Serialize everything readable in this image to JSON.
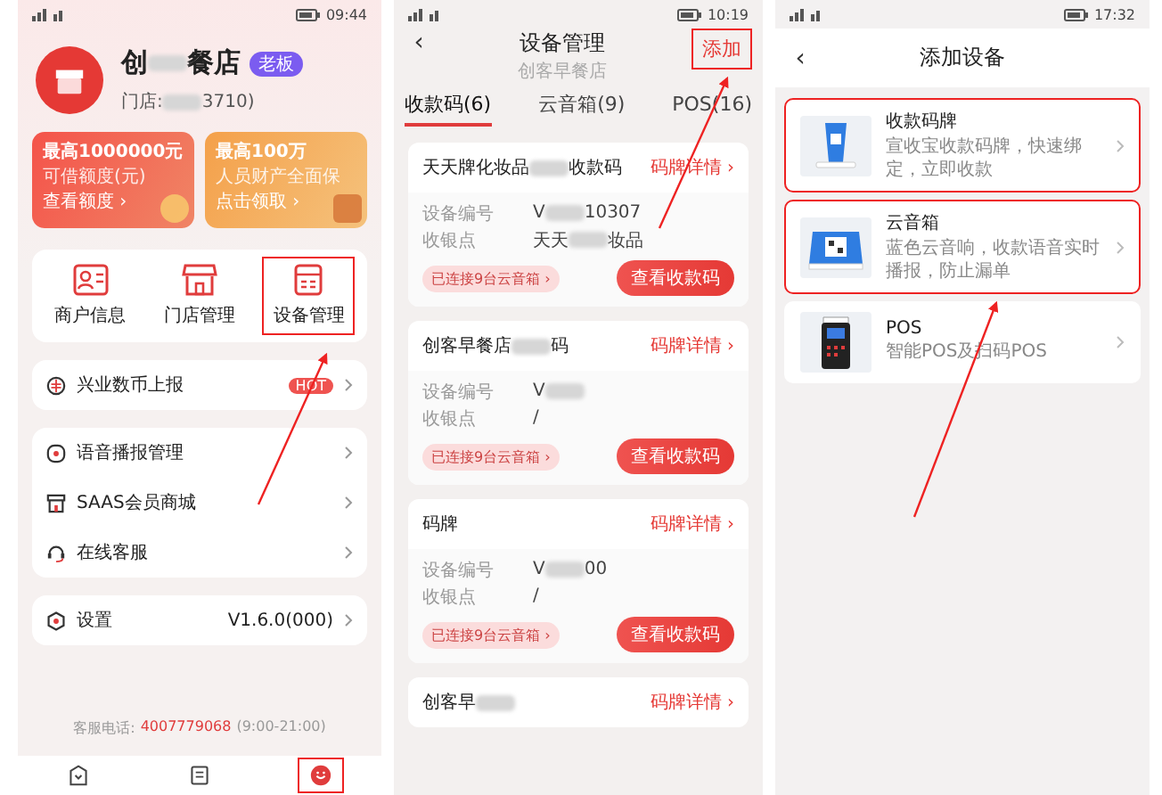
{
  "merchant_screen": {
    "status_bar": {
      "time": "09:44"
    },
    "store": {
      "name": {
        "before": "创",
        "after": "餐店"
      },
      "badge": "老板",
      "store_id": {
        "before": "门店:",
        "after": "3710)"
      }
    },
    "promos": [
      {
        "title": "最高1000000元",
        "subtitle": "可借额度(元)",
        "link": "查看额度 ›"
      },
      {
        "title": "最高100万",
        "subtitle": "人员财产全面保",
        "link": "点击领取 ›"
      }
    ],
    "shortcuts": [
      {
        "kind": "card",
        "label": "商户信息",
        "highlighted": false
      },
      {
        "kind": "shop",
        "label": "门店管理",
        "highlighted": false
      },
      {
        "kind": "device",
        "label": "设备管理",
        "highlighted": true
      }
    ],
    "menu_groups": [
      [
        {
          "kind": "coin",
          "label": "兴业数币上报",
          "badge": "HOT"
        }
      ],
      [
        {
          "kind": "speaker",
          "label": "语音播报管理"
        },
        {
          "kind": "shop",
          "label": "SAAS会员商城"
        },
        {
          "kind": "headset",
          "label": "在线客服"
        }
      ],
      [
        {
          "kind": "settings",
          "label": "设置",
          "value": "V1.6.0(000)"
        }
      ]
    ],
    "hotline": {
      "label": "客服电话:",
      "phone": "4007779068",
      "hours": "(9:00-21:00)"
    },
    "tab_bar": [
      {
        "kind": "home",
        "selected": false,
        "highlighted": false
      },
      {
        "kind": "orders",
        "selected": false,
        "highlighted": false
      },
      {
        "kind": "profile",
        "selected": true,
        "highlighted": true
      }
    ]
  },
  "device_screen": {
    "status_bar": {
      "time": "10:19"
    },
    "back": "‹",
    "title": "设备管理",
    "subtitle": "创客早餐店",
    "action": {
      "label": "添加",
      "highlighted": true
    },
    "tabs": [
      {
        "label": "收款码(6)",
        "selected": true
      },
      {
        "label": "云音箱(9)",
        "selected": false
      },
      {
        "label": "POS(16)",
        "selected": false
      }
    ],
    "devices": [
      {
        "name": {
          "before": "天天牌化妆品",
          "after": "收款码"
        },
        "link": "码牌详情 ›",
        "fields": [
          {
            "label": "设备编号",
            "value": {
              "before": "V",
              "after": "10307"
            }
          },
          {
            "label": "收银点",
            "value": {
              "before": "天天",
              "after": "妆品"
            }
          }
        ],
        "chip": "已连接9台云音箱 ›",
        "button": "查看收款码"
      },
      {
        "name": {
          "before": "创客早餐店",
          "after": "码"
        },
        "link": "码牌详情 ›",
        "fields": [
          {
            "label": "设备编号",
            "value": {
              "before": "V"
            }
          },
          {
            "label": "收银点",
            "value": "/"
          }
        ],
        "chip": "已连接9台云音箱 ›",
        "button": "查看收款码"
      },
      {
        "name": "码牌",
        "link": "码牌详情 ›",
        "fields": [
          {
            "label": "设备编号",
            "value": {
              "before": "V",
              "after": "00"
            }
          },
          {
            "label": "收银点",
            "value": "/"
          }
        ],
        "chip": "已连接9台云音箱 ›",
        "button": "查看收款码"
      },
      {
        "name": {
          "before": "创客早"
        },
        "link": "码牌详情 ›"
      }
    ]
  },
  "add_device_screen": {
    "status_bar": {
      "time": "17:32"
    },
    "back": "‹",
    "title": "添加设备",
    "options": [
      {
        "kind": "stand",
        "name": "收款码牌",
        "description": "宣收宝收款码牌，快速绑定，立即收款",
        "highlighted": true
      },
      {
        "kind": "speaker",
        "name": "云音箱",
        "description": "蓝色云音响，收款语音实时播报，防止漏单",
        "highlighted": true
      },
      {
        "kind": "pos",
        "name": "POS",
        "description": "智能POS及扫码POS",
        "highlighted": false
      }
    ]
  }
}
